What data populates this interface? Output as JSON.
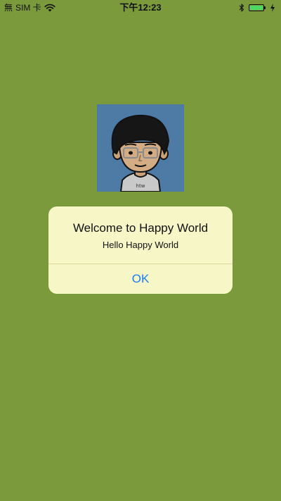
{
  "status_bar": {
    "signal": "無",
    "carrier": "SIM 卡",
    "time": "下午12:23",
    "battery_level": 1.0,
    "battery_color": "#4cd964"
  },
  "avatar": {
    "shirt_text": "htw"
  },
  "alert": {
    "title": "Welcome to Happy World",
    "message": "Hello Happy World",
    "button_label": "OK"
  },
  "colors": {
    "background": "#7b9a3c",
    "alert_background": "#f7f6c6",
    "button_text": "#1a7cf5"
  }
}
